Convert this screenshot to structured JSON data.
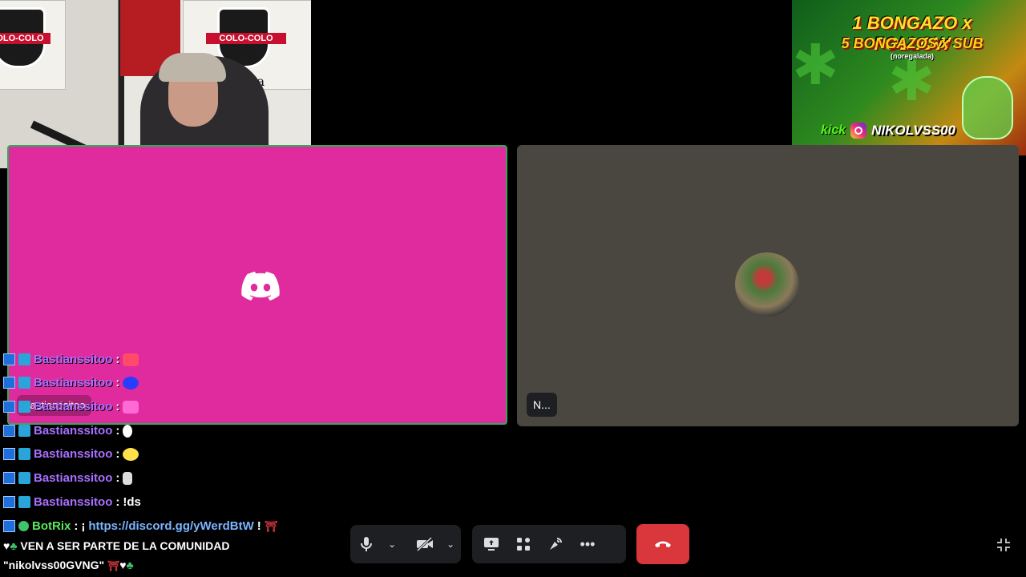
{
  "webcam": {
    "flag_left_text": "COLO-COLO",
    "flag_right_text": "COLO-COLO",
    "banner_text": "a Brava"
  },
  "promo": {
    "line1": "1 BONGAZO x FOLLOW",
    "line2": "5 BONGAZOS x SUB",
    "line3": "(noregalada)",
    "platform": "kick",
    "handle": "NIKOLVSS00"
  },
  "call": {
    "left_tile_name": "Bastianssitoo",
    "right_tile_name": "N..."
  },
  "chat": {
    "messages": [
      {
        "user": "Bastianssitoo",
        "text": "",
        "emote_color": "#ff4a6a"
      },
      {
        "user": "Bastianssitoo",
        "text": "",
        "emote_color": "#2a3cff"
      },
      {
        "user": "Bastianssitoo",
        "text": "",
        "emote_color": "#ff6ad5"
      },
      {
        "user": "Bastianssitoo",
        "text": "",
        "emote_color": "#ffffff"
      },
      {
        "user": "Bastianssitoo",
        "text": "",
        "emote_color": "#ffe14a"
      },
      {
        "user": "Bastianssitoo",
        "text": "",
        "emote_color": "#dddddd"
      },
      {
        "user": "Bastianssitoo",
        "text": "!ds",
        "emote_color": ""
      }
    ],
    "bot": {
      "user": "BotRix",
      "prefix": "¡",
      "link": "https://discord.gg/yWerdBtW",
      "suffix": "!",
      "line2": "VEN A SER PARTE DE LA COMUNIDAD",
      "line3": "\"nikolvss00GVNG\""
    }
  },
  "controls": {
    "mic_icon": "microphone-icon",
    "camera_icon": "camera-off-icon",
    "share_icon": "screen-share-icon",
    "activities_icon": "activities-icon",
    "soundboard_icon": "soundboard-icon",
    "more_icon": "more-icon",
    "end_call_icon": "phone-hangup-icon",
    "end_call_color": "#da373c"
  }
}
